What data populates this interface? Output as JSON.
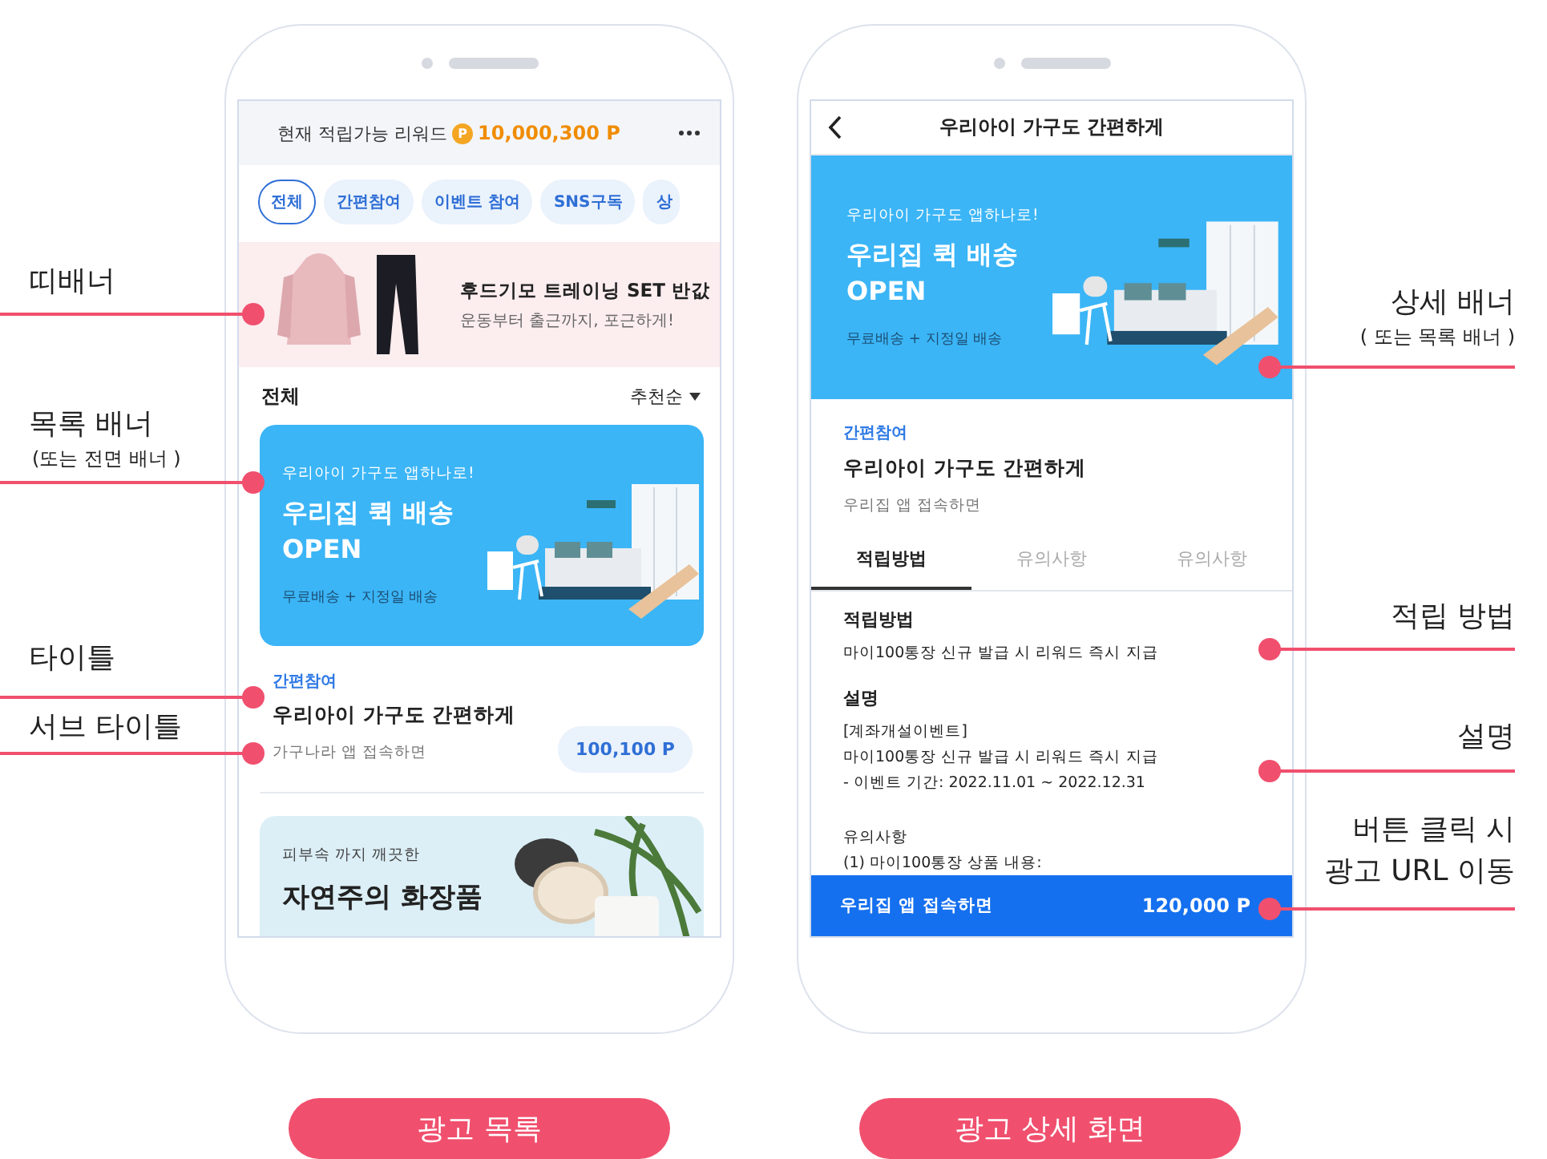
{
  "list_screen": {
    "reward_label": "현재 적립가능 리워드",
    "coin_symbol": "P",
    "reward_amount": "10,000,300 P",
    "filters": [
      {
        "label": "전체",
        "selected": true
      },
      {
        "label": "간편참여",
        "selected": false
      },
      {
        "label": "이벤트 참여",
        "selected": false
      },
      {
        "label": "SNS구독",
        "selected": false
      },
      {
        "label": "상",
        "selected": false
      }
    ],
    "strip_banner": {
      "title": "후드기모 트레이닝 SET 반값",
      "subtitle": "운동부터 출근까지, 포근하게!"
    },
    "section_title": "전체",
    "sort": "추천순",
    "cards": [
      {
        "banner": {
          "kind": "furniture",
          "eyebrow": "우리아이 가구도 앱하나로!",
          "headline": [
            "우리집 퀵 배송",
            "OPEN"
          ],
          "note": "무료배송 + 지정일 배송"
        },
        "category": "간편참여",
        "title": "우리아이 가구도 간편하게",
        "subtitle": "가구나라 앱 접속하면",
        "points": "100,100 P"
      },
      {
        "banner": {
          "kind": "cosmetics",
          "eyebrow": "피부속 까지 깨끗한",
          "headline": [
            "자연주의 화장품"
          ]
        }
      }
    ]
  },
  "detail_screen": {
    "nav_title": "우리아이 가구도 간편하게",
    "banner": {
      "kind": "furniture",
      "eyebrow": "우리아이 가구도 앱하나로!",
      "headline": [
        "우리집 퀵 배송",
        "OPEN"
      ],
      "note": "무료배송 + 지정일 배송"
    },
    "category": "간편참여",
    "title": "우리아이 가구도 간편하게",
    "subtitle": "우리집 앱 접속하면",
    "tabs": [
      {
        "label": "적립방법",
        "selected": true
      },
      {
        "label": "유의사항",
        "selected": false
      },
      {
        "label": "유의사항",
        "selected": false
      }
    ],
    "sections": [
      {
        "kind": "bold",
        "heading": "적립방법",
        "lines": [
          "마이100통장 신규 발급 시 리워드 즉시 지급"
        ]
      },
      {
        "kind": "bold",
        "heading": "설명",
        "lines": [
          "[계좌개설이벤트]",
          "마이100통장 신규 발급 시 리워드 즉시 지급",
          "- 이벤트 기간: 2022.11.01 ~ 2022.12.31"
        ]
      },
      {
        "kind": "plain",
        "heading": "유의사항",
        "lines": [
          "(1) 마이100통장 상품 내용:"
        ]
      }
    ],
    "cta": {
      "label": "우리집 앱 접속하면",
      "points": "120,000 P"
    }
  },
  "annotations": [
    {
      "kind": "left",
      "lines": [
        "띠배너"
      ]
    },
    {
      "kind": "left",
      "lines": [
        "목록 배너"
      ],
      "note": "(또는 전면 배너 )"
    },
    {
      "kind": "left",
      "lines": [
        "타이틀"
      ]
    },
    {
      "kind": "left",
      "lines": [
        "서브 타이틀"
      ]
    },
    {
      "kind": "right",
      "lines": [
        "상세 배너"
      ],
      "note": "( 또는 목록 배너 )"
    },
    {
      "kind": "right",
      "lines": [
        "적립 방법"
      ]
    },
    {
      "kind": "right",
      "lines": [
        "설명"
      ]
    },
    {
      "kind": "right",
      "lines": [
        "버튼 클릭 시",
        "광고 URL 이동"
      ]
    }
  ],
  "captions": [
    "광고 목록",
    "광고 상세 화면"
  ]
}
